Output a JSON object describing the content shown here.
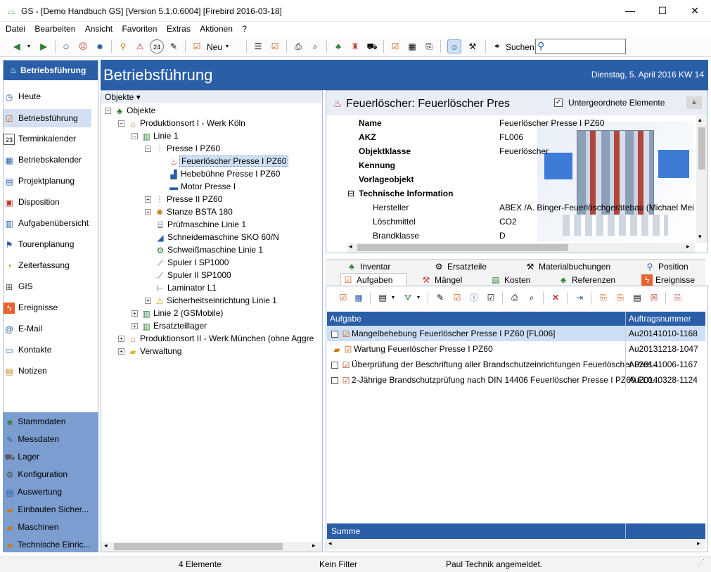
{
  "window": {
    "title": "GS - [Demo Handbuch GS]  [Version  5.1.0.6004]  [Firebird 2016-03-18]"
  },
  "menu": [
    "Datei",
    "Bearbeiten",
    "Ansicht",
    "Favoriten",
    "Extras",
    "Aktionen",
    "?"
  ],
  "toolbar": {
    "new_label": "Neu",
    "search_label": "Suchen",
    "search_value": ""
  },
  "nav": {
    "title": "Betriebsführung",
    "items": [
      "Heute",
      "Betriebsführung",
      "Terminkalender",
      "Betriebskalender",
      "Projektplanung",
      "Disposition",
      "Aufgabenübersicht",
      "Tourenplanung",
      "Zeiterfassung",
      "GIS",
      "Ereignisse",
      "E-Mail",
      "Kontakte",
      "Notizen"
    ],
    "lower": [
      "Stammdaten",
      "Messdaten",
      "Lager",
      "Konfiguration",
      "Auswertung",
      "Einbauten Sicher...",
      "Maschinen",
      "Technische Einric..."
    ]
  },
  "banner": {
    "title": "Betriebsführung",
    "date": "Dienstag, 5. April 2016  KW 14"
  },
  "tree": {
    "header": "Objekte ▾",
    "nodes": [
      "Objekte",
      "Produktionsort I - Werk Köln",
      "Linie 1",
      "Presse I PZ60",
      "Feuerlöscher Presse I PZ60",
      "Hebebühne Presse I PZ60",
      "Motor Presse I",
      "Presse II PZ60",
      "Stanze BSTA 180",
      "Prüfmaschine Linie 1",
      "Schneidemaschine SKO 60/N",
      "Schweißmaschine Linie 1",
      "Spuler I SP1000",
      "Spuler II SP1000",
      "Laminator L1",
      "Sicherheitseinrichtung Linie 1",
      "Linie 2 (GSMobile)",
      "Ersatzteillager",
      "Produktionsort II - Werk München (ohne Aggre",
      "Verwaltung"
    ]
  },
  "detail": {
    "title": "Feuerlöscher: Feuerlöscher Pres",
    "checkbox_label": "Untergeordnete Elemente",
    "props": [
      {
        "k": "Name",
        "v": "Feuerlöscher Presse I PZ60"
      },
      {
        "k": "AKZ",
        "v": "FL006"
      },
      {
        "k": "Objektklasse",
        "v": "Feuerlöscher"
      },
      {
        "k": "Kennung",
        "v": ""
      },
      {
        "k": "Vorlageobjekt",
        "v": ""
      },
      {
        "k": "Technische Information",
        "v": ""
      },
      {
        "k": "Hersteller",
        "v": "ABEX /A. Binger-Feuerlöschgerätebau   (Michael Mei"
      },
      {
        "k": "Löschmittel",
        "v": "CO2"
      },
      {
        "k": "Brandklasse",
        "v": "D"
      }
    ]
  },
  "tabs": {
    "row1": [
      "Inventar",
      "Ersatzteile",
      "Materialbuchungen",
      "Position"
    ],
    "row2": [
      "Aufgaben",
      "Mängel",
      "Kosten",
      "Referenzen",
      "Ereignisse"
    ]
  },
  "grid": {
    "columns": [
      "Aufgabe",
      "Auftragsnummer"
    ],
    "rows": [
      {
        "task": "Mangelbehebung Feuerlöscher Presse I PZ60 [FL006]",
        "nr": "Au20141010-1168"
      },
      {
        "task": "Wartung Feuerlöscher Presse I PZ60",
        "nr": "Au20131218-1047"
      },
      {
        "task": "Überprüfung der Beschriftung aller Brandschutzeinrichtungen Feuerlöscher Pres...",
        "nr": "Au20141006-1167"
      },
      {
        "task": "2-Jährige Brandschutzprüfung nach DIN 14406 Feuerlöscher Presse I PZ60 FL0...",
        "nr": "Au20140328-1124"
      }
    ],
    "sum_label": "Summe"
  },
  "status": {
    "count": "4 Elemente",
    "filter": "Kein Filter",
    "user": "Paul Technik angemeldet."
  }
}
